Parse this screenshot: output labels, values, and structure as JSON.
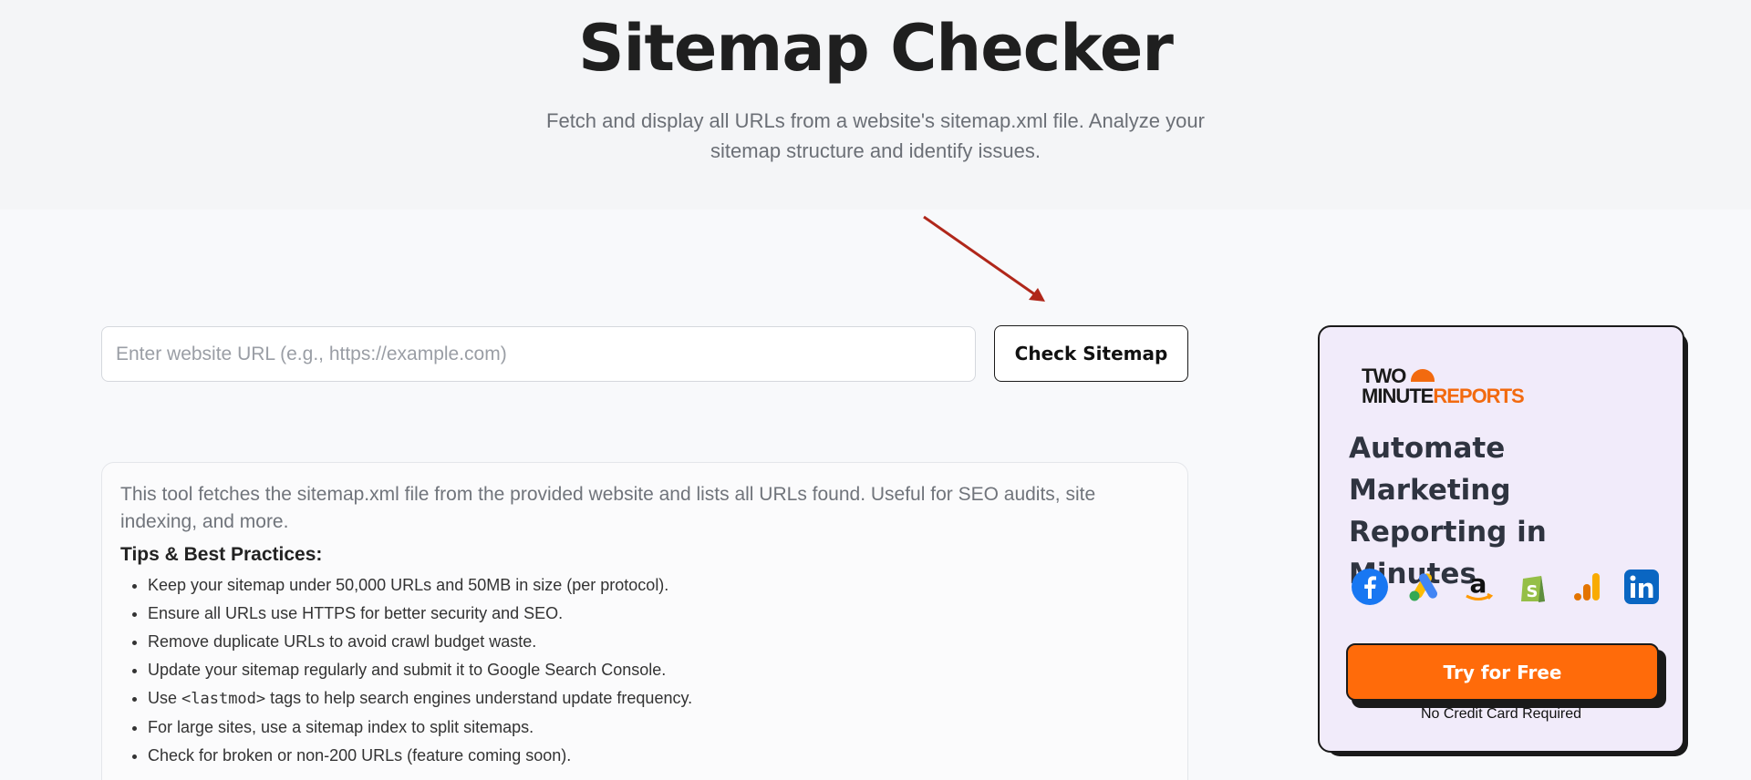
{
  "header": {
    "title": "Sitemap Checker",
    "subtitle": "Fetch and display all URLs from a website's sitemap.xml file. Analyze your sitemap structure and identify issues."
  },
  "form": {
    "url_placeholder": "Enter website URL (e.g., https://example.com)",
    "url_value": "",
    "submit_label": "Check Sitemap"
  },
  "info": {
    "description": "This tool fetches the sitemap.xml file from the provided website and lists all URLs found. Useful for SEO audits, site indexing, and more.",
    "tips_heading": "Tips & Best Practices:",
    "tips": [
      "Keep your sitemap under 50,000 URLs and 50MB in size (per protocol).",
      "Ensure all URLs use HTTPS for better security and SEO.",
      "Remove duplicate URLs to avoid crawl budget waste.",
      "Update your sitemap regularly and submit it to Google Search Console.",
      {
        "before": "Use ",
        "code": "<lastmod>",
        "after": " tags to help search engines understand update frequency."
      },
      "For large sites, use a sitemap index to split sitemaps.",
      "Check for broken or non-200 URLs (feature coming soon)."
    ]
  },
  "ad": {
    "logo_line1": "TWO",
    "logo_line2_a": "MINUTE",
    "logo_line2_b": "REPORTS",
    "heading": "Automate Marketing Reporting in Minutes",
    "brand_icons": [
      "facebook-icon",
      "google-ads-icon",
      "amazon-icon",
      "shopify-icon",
      "google-analytics-icon",
      "linkedin-icon"
    ],
    "cta_label": "Try for Free",
    "note": "No Credit Card Required",
    "colors": {
      "accent": "#ff6b0a",
      "card_bg": "#f1ebfa"
    }
  }
}
